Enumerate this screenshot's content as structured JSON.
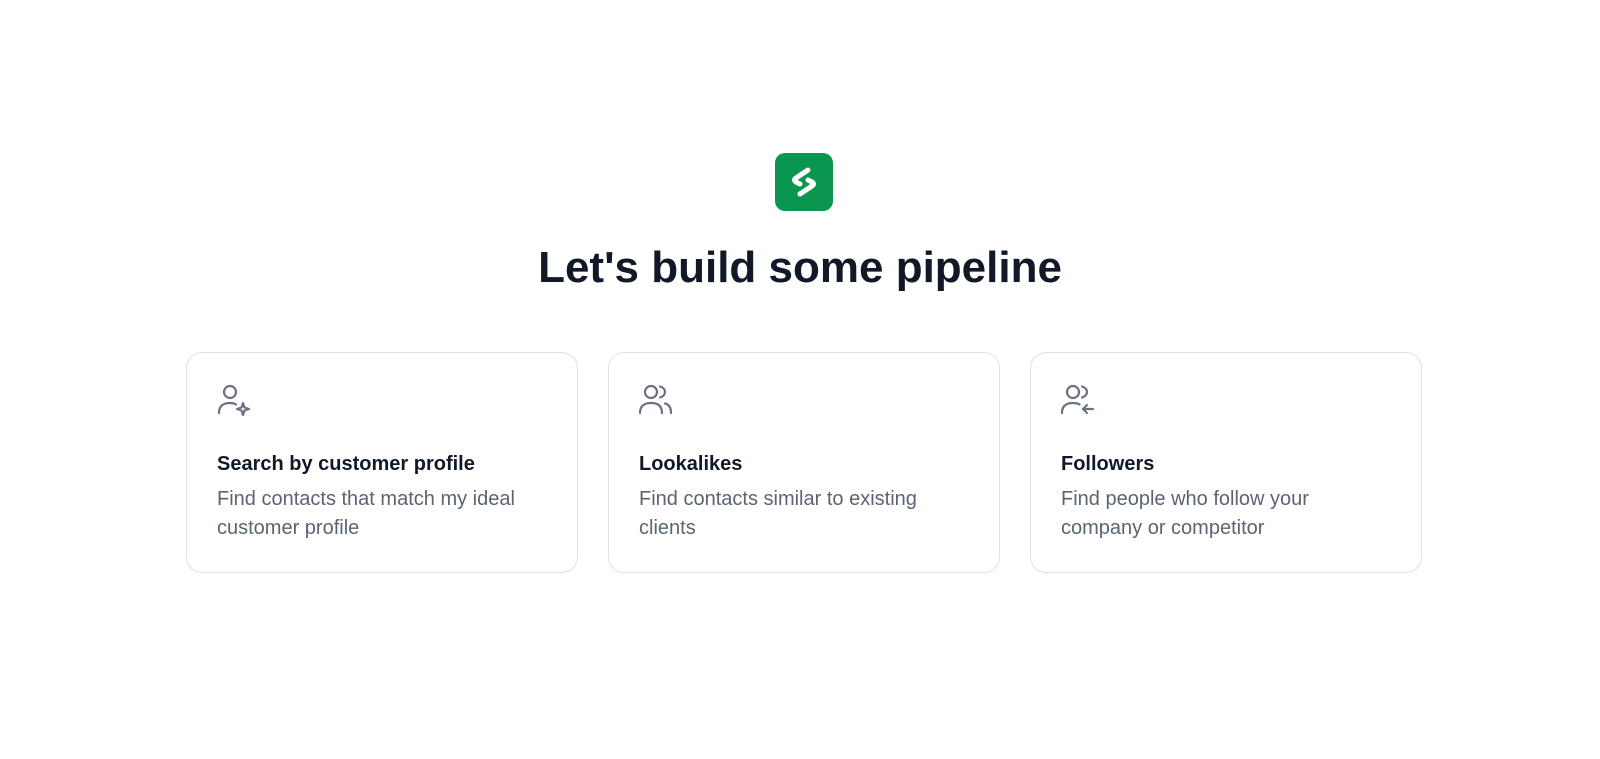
{
  "colors": {
    "brand": "#0b9650",
    "title": "#111827",
    "muted": "#5b6472",
    "border": "#dfe1e5",
    "icon": "#6b7280"
  },
  "logo": {
    "icon": "brand-logo-icon"
  },
  "heading": "Let's build some pipeline",
  "cards": [
    {
      "icon": "user-sparkle-icon",
      "title": "Search by customer profile",
      "description": "Find contacts that match my ideal customer profile"
    },
    {
      "icon": "users-icon",
      "title": "Lookalikes",
      "description": "Find contacts similar to existing clients"
    },
    {
      "icon": "user-follow-icon",
      "title": "Followers",
      "description": "Find people who follow your company or competitor"
    }
  ]
}
